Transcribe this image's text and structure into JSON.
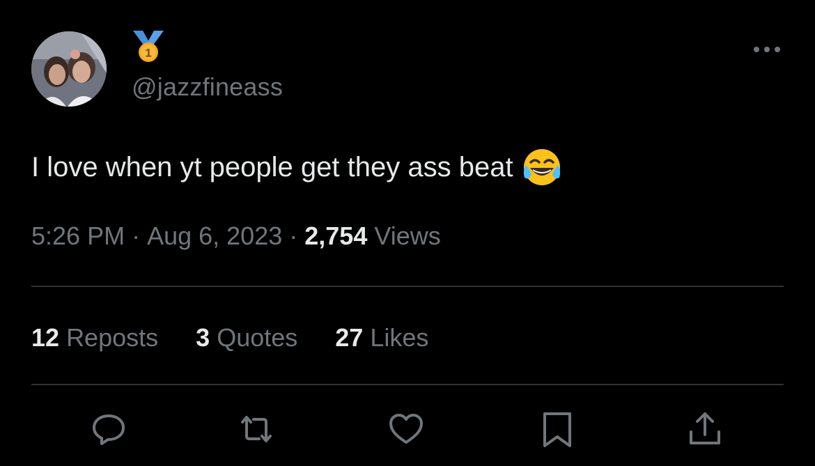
{
  "user": {
    "handle": "@jazzfineass",
    "badge_icon": "medal-icon",
    "badge_number": "1"
  },
  "tweet": {
    "text": "I love when yt people get they ass beat",
    "emoji": "face-with-tears-of-joy"
  },
  "meta": {
    "time": "5:26 PM",
    "separator": "·",
    "date": "Aug 6, 2023",
    "views_count": "2,754",
    "views_label": "Views"
  },
  "stats": {
    "reposts": {
      "count": "12",
      "label": "Reposts"
    },
    "quotes": {
      "count": "3",
      "label": "Quotes"
    },
    "likes": {
      "count": "27",
      "label": "Likes"
    }
  },
  "actions": [
    "reply-icon",
    "repost-icon",
    "like-icon",
    "bookmark-icon",
    "share-icon"
  ],
  "colors": {
    "background": "#000000",
    "primary_text": "#e7e9ea",
    "secondary_text": "#71767b",
    "divider": "#2f3336",
    "medal_gold": "#f6a821",
    "medal_ribbon": "#4a90d9"
  }
}
